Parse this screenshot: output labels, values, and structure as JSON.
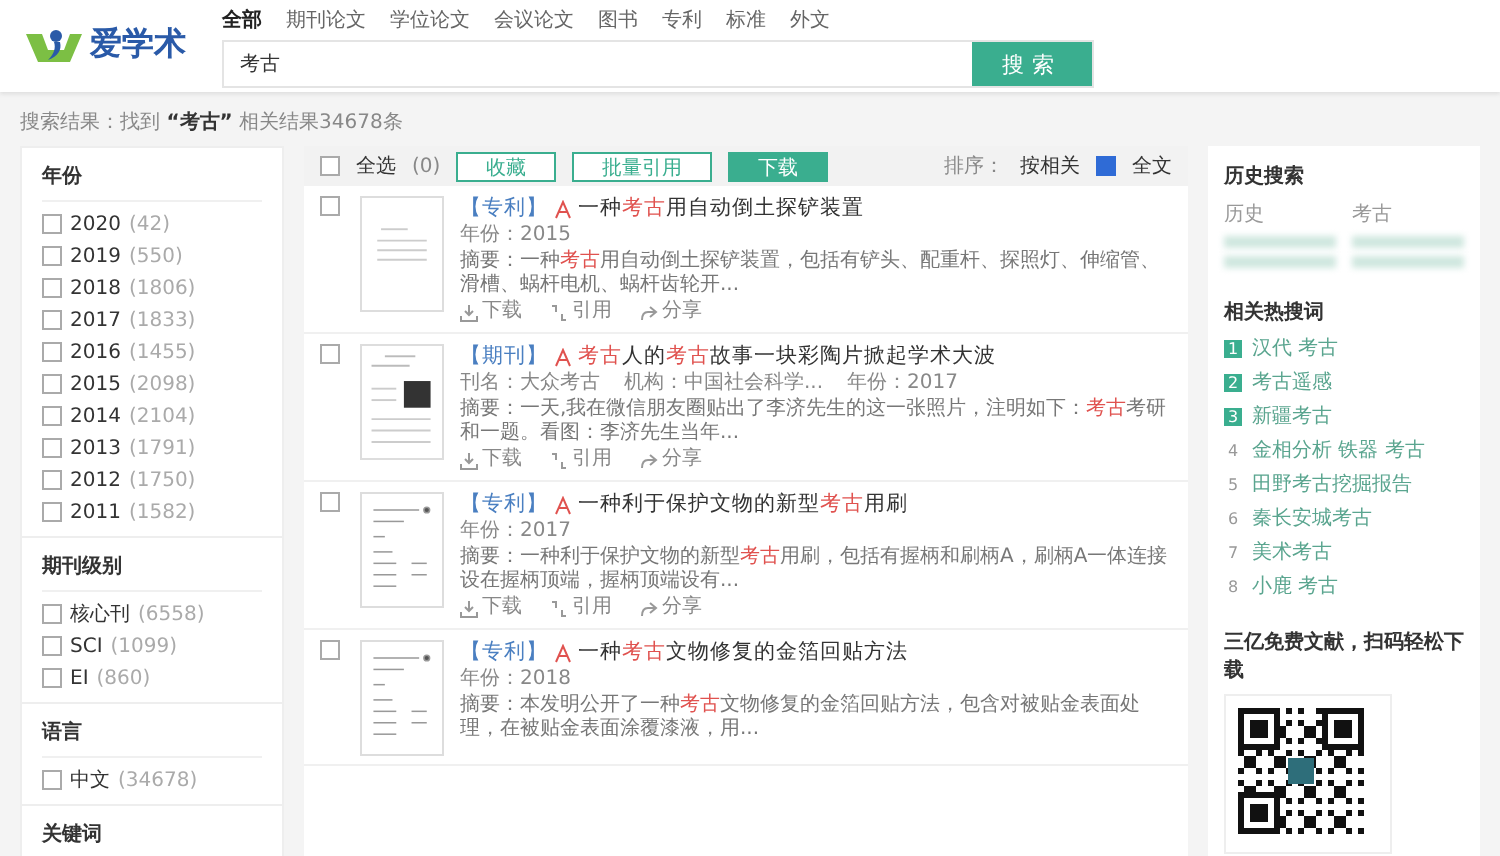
{
  "header": {
    "logo_text": "爱学术",
    "tabs": [
      {
        "label": "全部",
        "selected": true
      },
      {
        "label": "期刊论文",
        "selected": false
      },
      {
        "label": "学位论文",
        "selected": false
      },
      {
        "label": "会议论文",
        "selected": false
      },
      {
        "label": "图书",
        "selected": false
      },
      {
        "label": "专利",
        "selected": false
      },
      {
        "label": "标准",
        "selected": false
      },
      {
        "label": "外文",
        "selected": false
      }
    ],
    "search": {
      "value": "考古",
      "button": "搜索"
    }
  },
  "result_summary": {
    "prefix": "搜索结果：找到",
    "term": "“考古”",
    "suffix": "相关结果34678条"
  },
  "filters": [
    {
      "title": "年份",
      "items": [
        {
          "label": "2020",
          "count": "(42)",
          "checked": false
        },
        {
          "label": "2019",
          "count": "(550)",
          "checked": false
        },
        {
          "label": "2018",
          "count": "(1806)",
          "checked": false
        },
        {
          "label": "2017",
          "count": "(1833)",
          "checked": false
        },
        {
          "label": "2016",
          "count": "(1455)",
          "checked": false
        },
        {
          "label": "2015",
          "count": "(2098)",
          "checked": false
        },
        {
          "label": "2014",
          "count": "(2104)",
          "checked": false
        },
        {
          "label": "2013",
          "count": "(1791)",
          "checked": false
        },
        {
          "label": "2012",
          "count": "(1750)",
          "checked": false
        },
        {
          "label": "2011",
          "count": "(1582)",
          "checked": false
        }
      ]
    },
    {
      "title": "期刊级别",
      "items": [
        {
          "label": "核心刊",
          "count": "(6558)",
          "checked": false
        },
        {
          "label": "SCI",
          "count": "(1099)",
          "checked": false
        },
        {
          "label": "EI",
          "count": "(860)",
          "checked": false
        }
      ]
    },
    {
      "title": "语言",
      "items": [
        {
          "label": "中文",
          "count": "(34678)",
          "checked": false
        }
      ]
    },
    {
      "title": "关键词"
    }
  ],
  "toolbar": {
    "select_all": {
      "label": "全选",
      "count": "(0)",
      "checked": false
    },
    "buttons": [
      {
        "label": "收藏",
        "kind": "outline"
      },
      {
        "label": "批量引用",
        "kind": "outline"
      },
      {
        "label": "下载",
        "kind": "primary"
      }
    ],
    "sort_label": "排序：",
    "sort_value": "按相关",
    "fulltext": {
      "label": "全文",
      "checked": true
    }
  },
  "results": [
    {
      "type": "【专利】",
      "title": "一种**考古**用自动倒土探铲装置",
      "kind": "plain",
      "checked": false,
      "meta": [
        "年份：2015"
      ],
      "abstract": "摘要：一种**考古**用自动倒土探铲装置，包括有铲头、配重杆、探照灯、伸缩管、滑槽、蜗杆电机、蜗杆齿轮开...",
      "actions": [
        "下载",
        "引用",
        "分享"
      ]
    },
    {
      "type": "【期刊】",
      "title": "**考古**人的**考古**故事一块彩陶片掀起学术大波",
      "kind": "photo",
      "checked": false,
      "meta": [
        "刊名：大众考古",
        "机构：中国社会科学...",
        "年份：2017"
      ],
      "abstract": "摘要：一天,我在微信朋友圈贴出了李济先生的这一张照片，注明如下：**考古**考研和一题。看图：李济先生当年...",
      "actions": [
        "下载",
        "引用",
        "分享"
      ]
    },
    {
      "type": "【专利】",
      "title": "一种利于保护文物的新型**考古**用刷",
      "kind": "drawing",
      "checked": false,
      "meta": [
        "年份：2017"
      ],
      "abstract": "摘要：一种利于保护文物的新型**考古**用刷，包括有握柄和刷柄A，刷柄A一体连接设在握柄顶端，握柄顶端设有...",
      "actions": [
        "下载",
        "引用",
        "分享"
      ]
    },
    {
      "type": "【专利】",
      "title": "一种**考古**文物修复的金箔回贴方法",
      "kind": "drawing",
      "checked": false,
      "meta": [
        "年份：2018"
      ],
      "abstract": "摘要：本发明公开了一种**考古**文物修复的金箔回贴方法，包含对被贴金表面处理，在被贴金表面涂覆漆液，用..."
    }
  ],
  "sidebar": {
    "history_title": "历史搜索",
    "history": [
      {
        "term": "历史"
      },
      {
        "term": "考古"
      }
    ],
    "hot_title": "相关热搜词",
    "hot": [
      {
        "rank": "1",
        "term": "汉代 考古",
        "top": true
      },
      {
        "rank": "2",
        "term": "考古遥感",
        "top": true
      },
      {
        "rank": "3",
        "term": "新疆考古",
        "top": true
      },
      {
        "rank": "4",
        "term": "金相分析 铁器 考古",
        "top": false
      },
      {
        "rank": "5",
        "term": "田野考古挖掘报告",
        "top": false
      },
      {
        "rank": "6",
        "term": "秦长安城考古",
        "top": false
      },
      {
        "rank": "7",
        "term": "美术考古",
        "top": false
      },
      {
        "rank": "8",
        "term": "小鹿 考古",
        "top": false
      }
    ],
    "promo": "三亿免费文献，扫码轻松下载"
  }
}
